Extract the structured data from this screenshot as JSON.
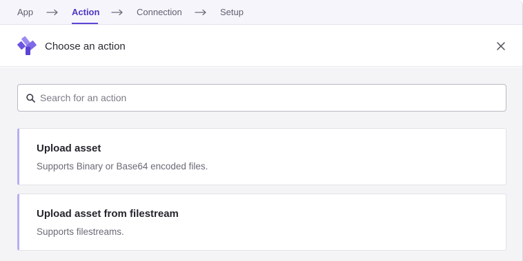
{
  "stepper": {
    "steps": [
      {
        "label": "App",
        "active": false
      },
      {
        "label": "Action",
        "active": true
      },
      {
        "label": "Connection",
        "active": false
      },
      {
        "label": "Setup",
        "active": false
      }
    ]
  },
  "header": {
    "title": "Choose an action",
    "close_icon": "close-icon",
    "logo_icon": "app-logo"
  },
  "search": {
    "placeholder": "Search for an action",
    "value": "",
    "icon": "search-icon"
  },
  "actions": [
    {
      "title": "Upload asset",
      "description": "Supports Binary or Base64 encoded files."
    },
    {
      "title": "Upload asset from filestream",
      "description": "Supports filestreams."
    }
  ],
  "colors": {
    "accent": "#5b45d6",
    "card_border_accent": "#b7aef0",
    "stepper_bg": "#f6f5fc",
    "body_bg": "#f4f4f6"
  }
}
